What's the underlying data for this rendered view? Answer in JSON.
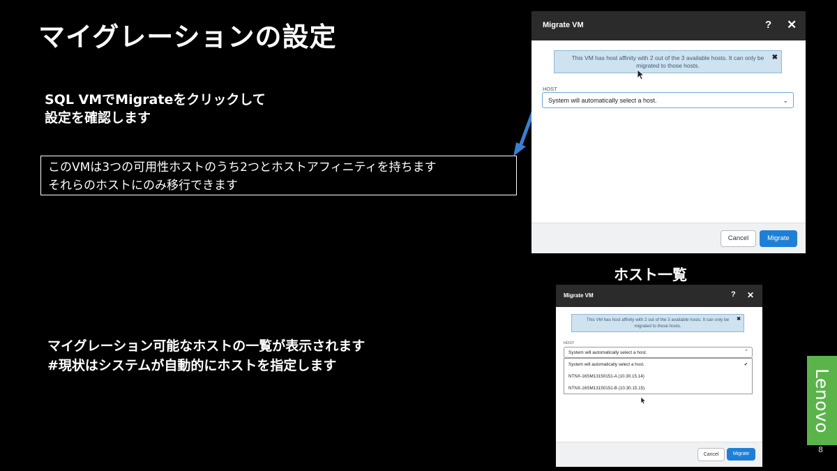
{
  "slide": {
    "title": "マイグレーションの設定",
    "step1_line1": "SQL VMでMigrateをクリックして",
    "step1_line2": "設定を確認します",
    "callout_line1": "このVMは3つの可用性ホストのうち2つとホストアフィニティを持ちます",
    "callout_line2": "それらのホストにのみ移行できます",
    "step2_line1": "マイグレーション可能なホストの一覧が表示されます",
    "step2_line2": "#現状はシステムが自動的にホストを指定します",
    "host_list_label": "ホスト一覧",
    "page_number": "8",
    "brand": "Lenovo",
    "arrow_color": "#3a7fd0",
    "brand_color": "#5ab44a"
  },
  "dialog1": {
    "title": "Migrate VM",
    "help_icon": "question-icon",
    "close_icon": "close-icon",
    "alert_line1": "This VM has host affinity with 2 out of the 3 available hosts. It can only be",
    "alert_line2": "migrated to those hosts.",
    "host_label": "HOST",
    "host_value": "System will automatically select a host.",
    "cancel_label": "Cancel",
    "migrate_label": "Migrate"
  },
  "dialog2": {
    "title": "Migrate VM",
    "alert_line1": "This VM has host affinity with 2 out of the 3 available hosts. It can only be",
    "alert_line2": "migrated to those hosts.",
    "host_label": "HOST",
    "host_value": "System will automatically select a host.",
    "options": [
      "System will automatically select a host.",
      "NTNX-16SM13150151-A   (10.30.15.14)",
      "NTNX-16SM13150151-B   (10.30.15.15)"
    ],
    "cancel_label": "Cancel",
    "migrate_label": "Migrate"
  }
}
